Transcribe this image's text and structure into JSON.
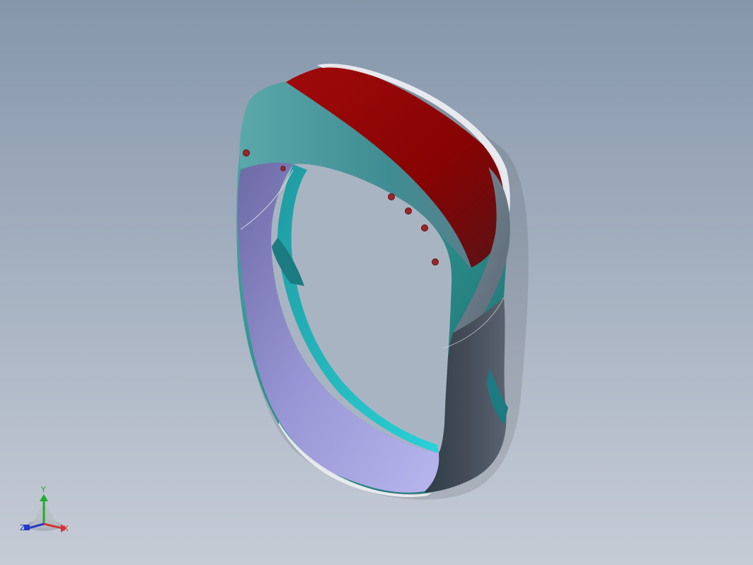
{
  "viewport": {
    "background_top": "#8596ab",
    "background_bottom": "#c6ccd6"
  },
  "model": {
    "name": "",
    "body_color": "#2f8f8d",
    "inner_band_color": "#9a98d6",
    "top_face_color": "#8a0406",
    "edge_highlight_color": "#e6e8ec",
    "pin_color": "#a1262a",
    "shadow_band_color": "#3c424c"
  },
  "triad": {
    "y_label": "Y",
    "z_label": "Z",
    "x_label": "X",
    "y_color": "#1fae2a",
    "z_color": "#2a38c8",
    "x_color": "#d43434"
  }
}
